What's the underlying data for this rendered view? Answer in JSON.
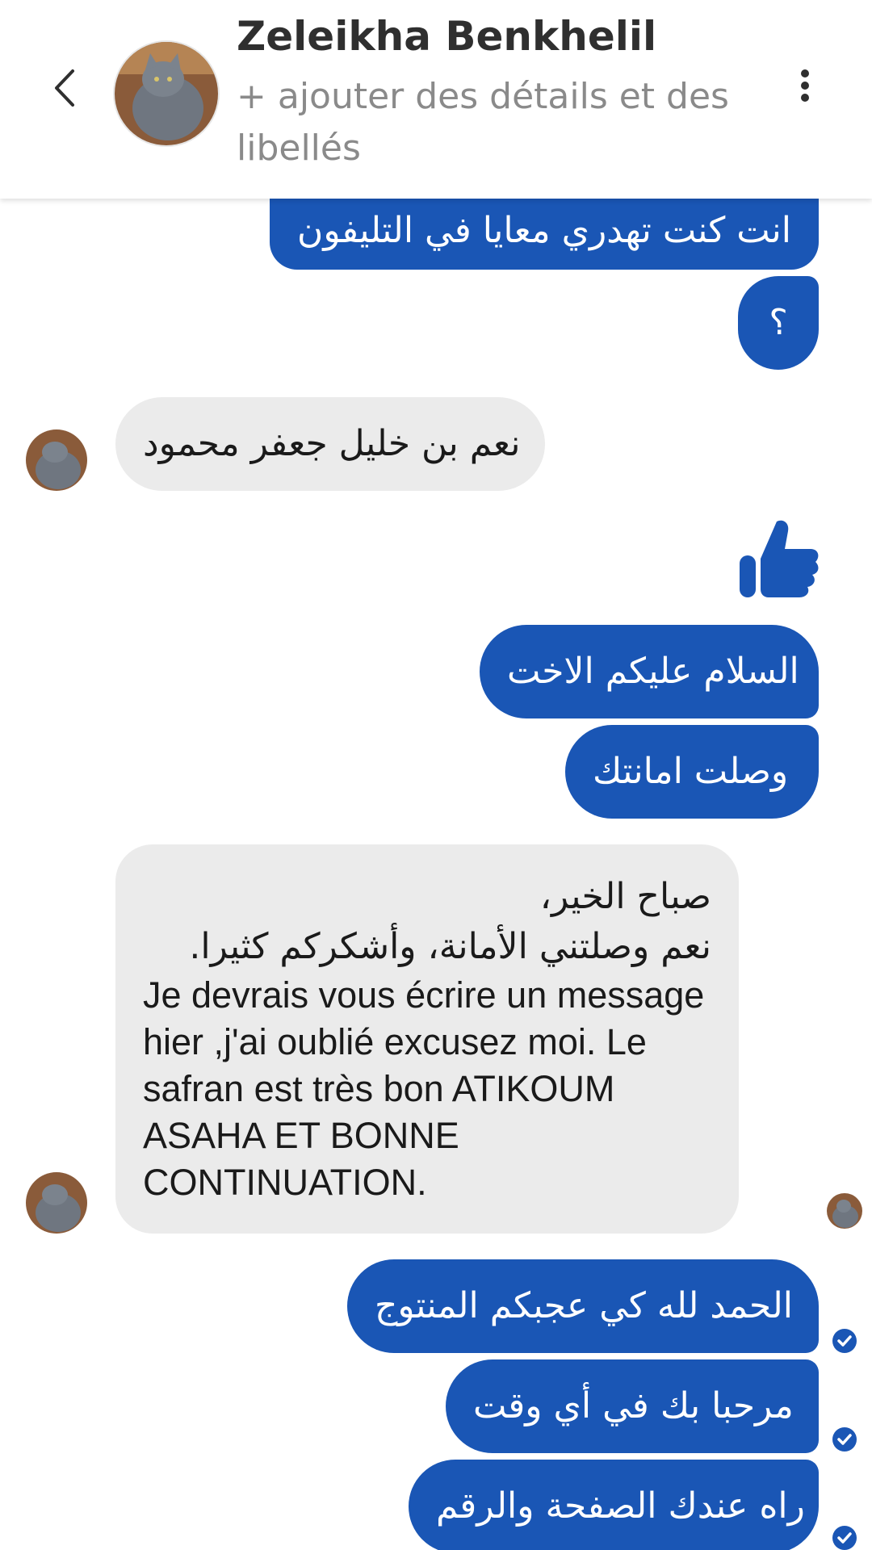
{
  "header": {
    "contact_name": "Zeleikha Benkhelil",
    "subtitle": "+ ajouter des détails et des libellés",
    "back_icon": "chevron-left-icon",
    "more_icon": "more-vertical-icon"
  },
  "messages": {
    "m1": "انت كنت تهدري معايا في التليفون",
    "m2": "؟",
    "m3": "نعم بن خليل جعفر محمود",
    "m5": "السلام عليكم الاخت",
    "m6": "وصلت امانتك",
    "m7_line1": "صباح الخير،",
    "m7_line2": "نعم وصلتني الأمانة، وأشكركم كثيرا.",
    "m7_french": "Je devrais vous écrire un message hier ,j'ai oublié excusez moi. Le safran est très bon ATIKOUM ASAHA ET BONNE CONTINUATION.",
    "m8": "الحمد لله كي عجبكم المنتوج",
    "m9": "مرحبا بك في أي وقت",
    "m10": "راه عندك الصفحة والرقم"
  },
  "colors": {
    "outgoing_bubble": "#1a56b5",
    "incoming_bubble": "#ebebeb",
    "like_icon": "#1a56b5"
  },
  "icons": {
    "like": "thumbs-up-icon",
    "read_receipt": "check-circle-icon"
  }
}
